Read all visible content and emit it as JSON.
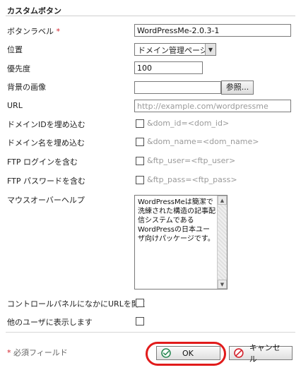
{
  "section_title": "カスタムボタン",
  "fields": {
    "button_label": {
      "label": "ボタンラベル",
      "required_mark": "*",
      "value": "WordPressMe-2.0.3-1"
    },
    "position": {
      "label": "位置",
      "selected": "ドメイン管理ページ"
    },
    "priority": {
      "label": "優先度",
      "value": "100"
    },
    "background_image": {
      "label": "背景の画像",
      "value": "",
      "browse_label": "参照..."
    },
    "url": {
      "label": "URL",
      "value": "http://example.com/wordpressme"
    },
    "include_domain_id": {
      "label": "ドメインIDを埋め込む",
      "param": "&dom_id=<dom_id>",
      "checked": false
    },
    "include_domain_name": {
      "label": "ドメイン名を埋め込む",
      "param": "&dom_name=<dom_name>",
      "checked": false
    },
    "include_ftp_login": {
      "label": "FTP ログインを含む",
      "param": "&ftp_user=<ftp_user>",
      "checked": false
    },
    "include_ftp_password": {
      "label": "FTP パスワードを含む",
      "param": "&ftp_pass=<ftp_pass>",
      "checked": false
    },
    "mouseover_help": {
      "label": "マウスオーバーヘルプ",
      "value": "WordPressMeは簡潔で洗練された構造の記事配信システムであるWordPressの日本ユーザ向けパッケージです。"
    },
    "open_url_in_control_panel": {
      "label": "コントロールパネルになかにURLを開く",
      "checked": false
    },
    "show_to_other_users": {
      "label": "他のユーザに表示します",
      "checked": false
    }
  },
  "footer": {
    "required_note_mark": "*",
    "required_note_text": "必須フィールド",
    "ok_label": "OK",
    "cancel_label": "キャンセル"
  },
  "colors": {
    "required": "#d3212b",
    "ok_icon": "#2e8b57",
    "cancel_icon": "#d3212b",
    "highlight_ring": "#e11b1b"
  },
  "icons": {
    "ok": "check-circle-icon",
    "cancel": "no-entry-icon",
    "select_arrow": "chevron-down-icon"
  }
}
